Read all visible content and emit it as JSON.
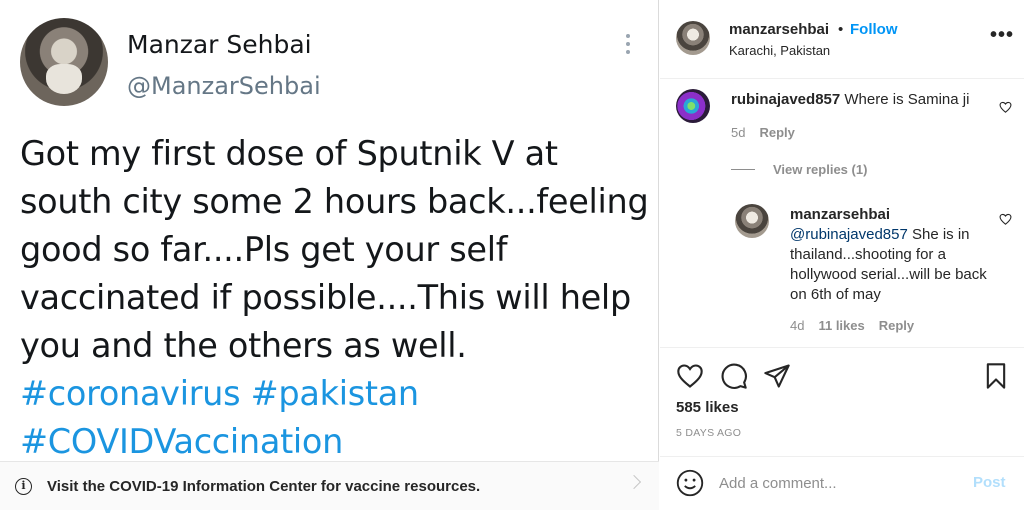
{
  "tweet": {
    "name": "Manzar Sehbai",
    "handle": "@ManzarSehbai",
    "text_plain": "Got my first dose of Sputnik V at south city some 2 hours back...feeling good so far....Pls get your self vaccinated if possible....This will help you and the others as well.",
    "hashtags": [
      "#coronavirus",
      "#pakistan",
      "#COVIDVaccination"
    ],
    "info_bar": "Visit the COVID-19 Information Center for vaccine resources.",
    "icons": {
      "more": "kebab-icon",
      "info": "info-circle-icon",
      "chevron": "chevron-right-icon"
    }
  },
  "post_header": {
    "username": "manzarsehbai",
    "separator": "•",
    "follow_label": "Follow",
    "location": "Karachi, Pakistan",
    "more_label": "•••"
  },
  "comments": [
    {
      "username": "rubinajaved857",
      "text": "Where is Samina ji",
      "age": "5d",
      "reply_label": "Reply",
      "view_replies_label": "View replies (1)"
    }
  ],
  "reply": {
    "username": "manzarsehbai",
    "mention": "@rubinajaved857",
    "text": " She is in thailand...shooting for a hollywood serial...will be back on 6th of may",
    "age": "4d",
    "likes_label": "11 likes",
    "reply_label": "Reply"
  },
  "actions": {
    "likes": "585 likes",
    "timestamp": "5 DAYS AGO",
    "icons": [
      "heart-icon",
      "comment-icon",
      "share-icon",
      "bookmark-icon"
    ]
  },
  "add_comment": {
    "placeholder": "Add a comment...",
    "post_label": "Post"
  },
  "colors": {
    "link_blue": "#0095f6",
    "hashtag_blue": "#1b95e0",
    "muted": "#8e8e8e",
    "post_disabled": "#b2dffc"
  }
}
